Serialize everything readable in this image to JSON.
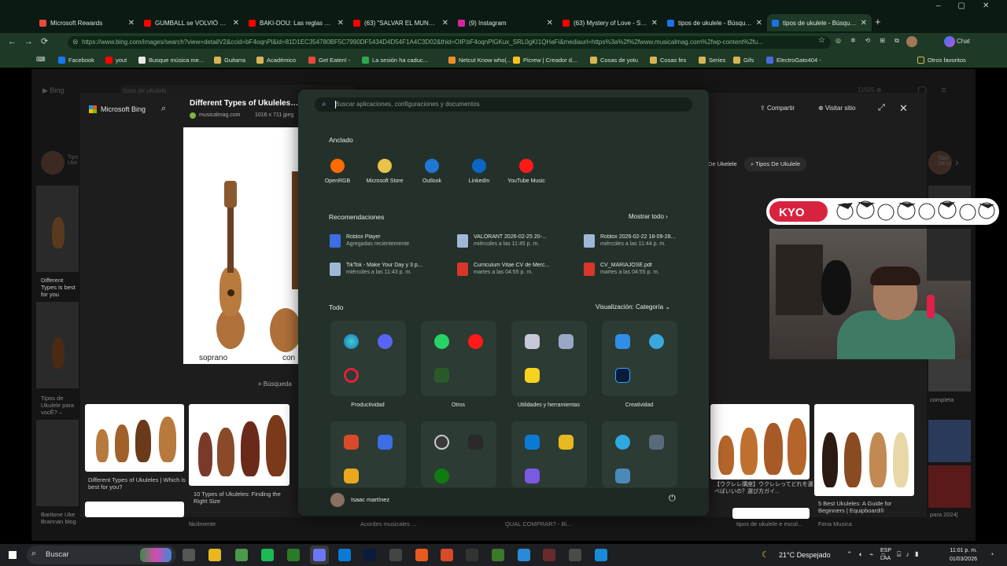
{
  "browser": {
    "tabs": [
      {
        "label": "Microsoft Rewards",
        "color": "#e84a3a"
      },
      {
        "label": "GUMBALL se VOLVIÓ SOUTH",
        "color": "#ff0000"
      },
      {
        "label": "BAKI-DOU: Las reglas del comb",
        "color": "#ff0000"
      },
      {
        "label": "(63) \"SALVAR EL MUNDO... D",
        "color": "#ff0000"
      },
      {
        "label": "(9) Instagram",
        "color": "#d6249f"
      },
      {
        "label": "(63) Mystery of Love - Sufjan",
        "color": "#ff0000"
      },
      {
        "label": "tipos de ukulele - Búsqueda",
        "color": "#1a73e8"
      },
      {
        "label": "tipos de ukulele - Búsqueda",
        "color": "#1a73e8"
      }
    ],
    "new_tab": "+",
    "url": "https://www.bing.com/images/search?view=detailV2&ccid=bF4oqnPl&id=81D1EC354780BF5C7990DF5434D4D54F1A4C3D02&thid=OIP.bF4oqnPlGKux_SRL0gKI1QHaFi&mediaurl=https%3a%2f%2fwww.musicalmag.com%2fwp-content%2fu...",
    "bookmarks": [
      "Facebook",
      "yout",
      "Busque música me...",
      "Guitarra",
      "Académico",
      "Get Eaten! -",
      "La sesión ha caduc...",
      "Netcut Know who(...",
      "Picrew | Creador d...",
      "Cosas de yotu",
      "Cosas fes",
      "Series",
      "Gifs",
      "ElectroGato404 -"
    ],
    "other_bookmarks": "Otros favoritos"
  },
  "bing": {
    "brand": "Microsoft Bing",
    "bg_search": "tipos de ukulele",
    "image_title": "Different Types of Ukuleles | W",
    "source": "musicalmag.com",
    "size": "1016 x 711 jpeg",
    "share": "Compartir",
    "visit": "Visitar sitio",
    "caption_left": "soprano",
    "caption_right": "con",
    "visual_search": "Búsqueda",
    "related_chips": [
      "De Ukelele",
      "Tipos De Ukulele"
    ],
    "captions": [
      "Different Types of Ukuleles | Which is best for you?",
      "10 Types of Ukuleles: Finding the Right Size",
      "【ウクレレ講座】ウクレレってどれを選べばいいの？選び方ガイ...",
      "5 Best Ukuleles: A Guide for Beginners | Equipboard®",
      "Different Types is best for you",
      "Tipos de Ukulele para vocÊ? –",
      "Baritone Uke Brannan blog",
      "completa",
      "para 2024|",
      "Fena Musica",
      "tipos de ukulele e escol...",
      "Acordes musicales ...",
      "QUAL COMPRAR? - Bl...",
      "fácilmente"
    ]
  },
  "start_menu": {
    "search_placeholder": "Buscar aplicaciones, configuraciones y documentos",
    "pinned_title": "Anclado",
    "pinned": [
      {
        "label": "OpenRGB",
        "icon": "openrgb-icon",
        "color": "#ff6b00"
      },
      {
        "label": "Microsoft Store",
        "icon": "store-icon",
        "color": "#e8c24a"
      },
      {
        "label": "Outlook",
        "icon": "outlook-icon",
        "color": "#1e78d4"
      },
      {
        "label": "LinkedIn",
        "icon": "linkedin-icon",
        "color": "#0a66c2"
      },
      {
        "label": "YouTube Music",
        "icon": "youtube-music-icon",
        "color": "#ff1a1a"
      }
    ],
    "rec_title": "Recomendaciones",
    "show_all": "Mostrar todo",
    "recommendations": [
      {
        "name": "Roblox Player",
        "sub": "Agregadas recientemente",
        "color": "#3c6ee6"
      },
      {
        "name": "VALORANT   2026-02-25 20-...",
        "sub": "miércoles a las 11:45 p. m.",
        "color": "#9fb8d8"
      },
      {
        "name": "Roblox 2026-02-22 18-09-28...",
        "sub": "miércoles a las 11:44 p. m.",
        "color": "#9fb8d8"
      },
      {
        "name": "TikTok - Make Your Day y 3 p...",
        "sub": "miércoles a las 11:43 p. m.",
        "color": "#9fb8d8"
      },
      {
        "name": "Curriculum Vitae CV de Merc...",
        "sub": "martes a las 04:55 p. m.",
        "color": "#d8362a"
      },
      {
        "name": "CV_MARIAJOSE.pdf",
        "sub": "martes a las 04:55 p. m.",
        "color": "#d8362a"
      }
    ],
    "all_title": "Todo",
    "view_mode": "Visualización: Categoría",
    "categories": [
      "Productividad",
      "Otros",
      "Utilidades y herramientas",
      "Creatividad"
    ],
    "user_name": "Isaac martínez"
  },
  "stream": {
    "tag": "KYO"
  },
  "taskbar": {
    "search": "Buscar",
    "weather": "21°C  Despejado",
    "lang1": "ESP",
    "lang2": "LAA",
    "time": "11:01 p. m.",
    "date": "01/03/2026"
  }
}
